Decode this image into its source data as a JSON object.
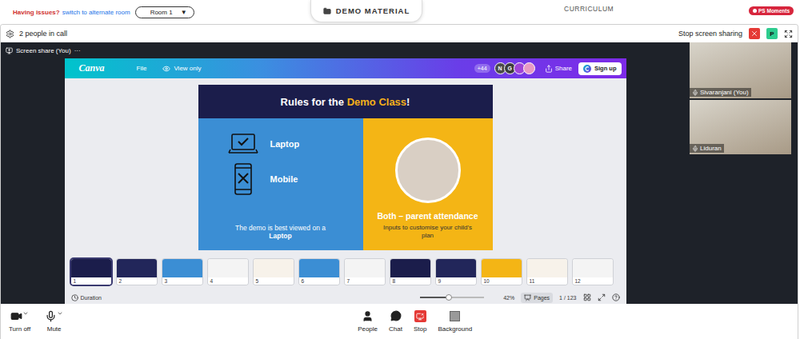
{
  "top_bar": {
    "issue_text": "Having issues?",
    "link": "switch to alternate room",
    "room_select": {
      "value": "Room 1",
      "arrow": "▼"
    },
    "tabs": [
      {
        "label": "DEMO MATERIAL",
        "selected": true
      },
      {
        "label": "CURRICULUM",
        "selected": false
      }
    ],
    "badge": "PS Moments"
  },
  "call_header": {
    "people_count": "2 people in call",
    "stop_sharing": "Stop screen sharing",
    "user_initial": "P"
  },
  "screen_share": {
    "label": "Screen share (You)",
    "menu": "···"
  },
  "canva": {
    "logo": "Canva",
    "menu": [
      "File"
    ],
    "view_mode": "View only",
    "collaborator_count": "+44",
    "avatars": [
      {
        "initial": "N",
        "kind": "letter",
        "color": "#4b4b4b"
      },
      {
        "initial": "G",
        "kind": "letter",
        "color": "#3d3d3d"
      },
      {
        "initial": "",
        "kind": "image",
        "color": "#a044d8"
      },
      {
        "initial": "",
        "kind": "image",
        "color": "#e79ac4"
      }
    ],
    "share": "Share",
    "sign_up": "Sign up"
  },
  "slide": {
    "title": [
      {
        "text": "Rules for the ",
        "highlight": false
      },
      {
        "text": "Demo Class",
        "highlight": true
      },
      {
        "text": "!",
        "highlight": false
      }
    ],
    "devices": [
      {
        "label": "Laptop",
        "kind": "laptop",
        "allowed": true
      },
      {
        "label": "Mobile",
        "kind": "mobile",
        "allowed": false
      }
    ],
    "note": [
      {
        "text": "The demo is best viewed on a ",
        "bold": false
      },
      {
        "text": "Laptop",
        "bold": true
      }
    ],
    "attendance": {
      "heading": "Both – parent attendance",
      "text": "Inputs to customise your child's plan"
    }
  },
  "thumbnails": [
    {
      "number": "1",
      "color": "#1b1d4b",
      "selected": true
    },
    {
      "number": "2",
      "color": "#22265a",
      "selected": false
    },
    {
      "number": "3",
      "color": "#3b8ed4",
      "selected": false
    },
    {
      "number": "4",
      "color": "#f4f4f4",
      "selected": false
    },
    {
      "number": "5",
      "color": "#f7f2ea",
      "selected": false
    },
    {
      "number": "6",
      "color": "#3b8ed4",
      "selected": false
    },
    {
      "number": "7",
      "color": "#f4f4f4",
      "selected": false
    },
    {
      "number": "8",
      "color": "#1b1d4b",
      "selected": false
    },
    {
      "number": "9",
      "color": "#22265a",
      "selected": false
    },
    {
      "number": "10",
      "color": "#f4b515",
      "selected": false
    },
    {
      "number": "11",
      "color": "#f7f2ea",
      "selected": false
    },
    {
      "number": "12",
      "color": "#f4f4f4",
      "selected": false
    }
  ],
  "footer": {
    "duration": "Duration",
    "zoom": {
      "level": 0.45,
      "reading": "42%"
    },
    "pages": "Pages",
    "page_count": "1 / 123"
  },
  "participants": [
    {
      "name": "Sivaranjani (You)"
    },
    {
      "name": "Liduran"
    }
  ],
  "toolbar": {
    "left": [
      {
        "label": "Turn off",
        "kind": "camera"
      },
      {
        "label": "Mute",
        "kind": "mic"
      }
    ],
    "center": [
      {
        "label": "People",
        "kind": "people"
      },
      {
        "label": "Chat",
        "kind": "chat"
      },
      {
        "label": "Stop",
        "kind": "stop"
      },
      {
        "label": "Background",
        "kind": "background"
      }
    ]
  }
}
